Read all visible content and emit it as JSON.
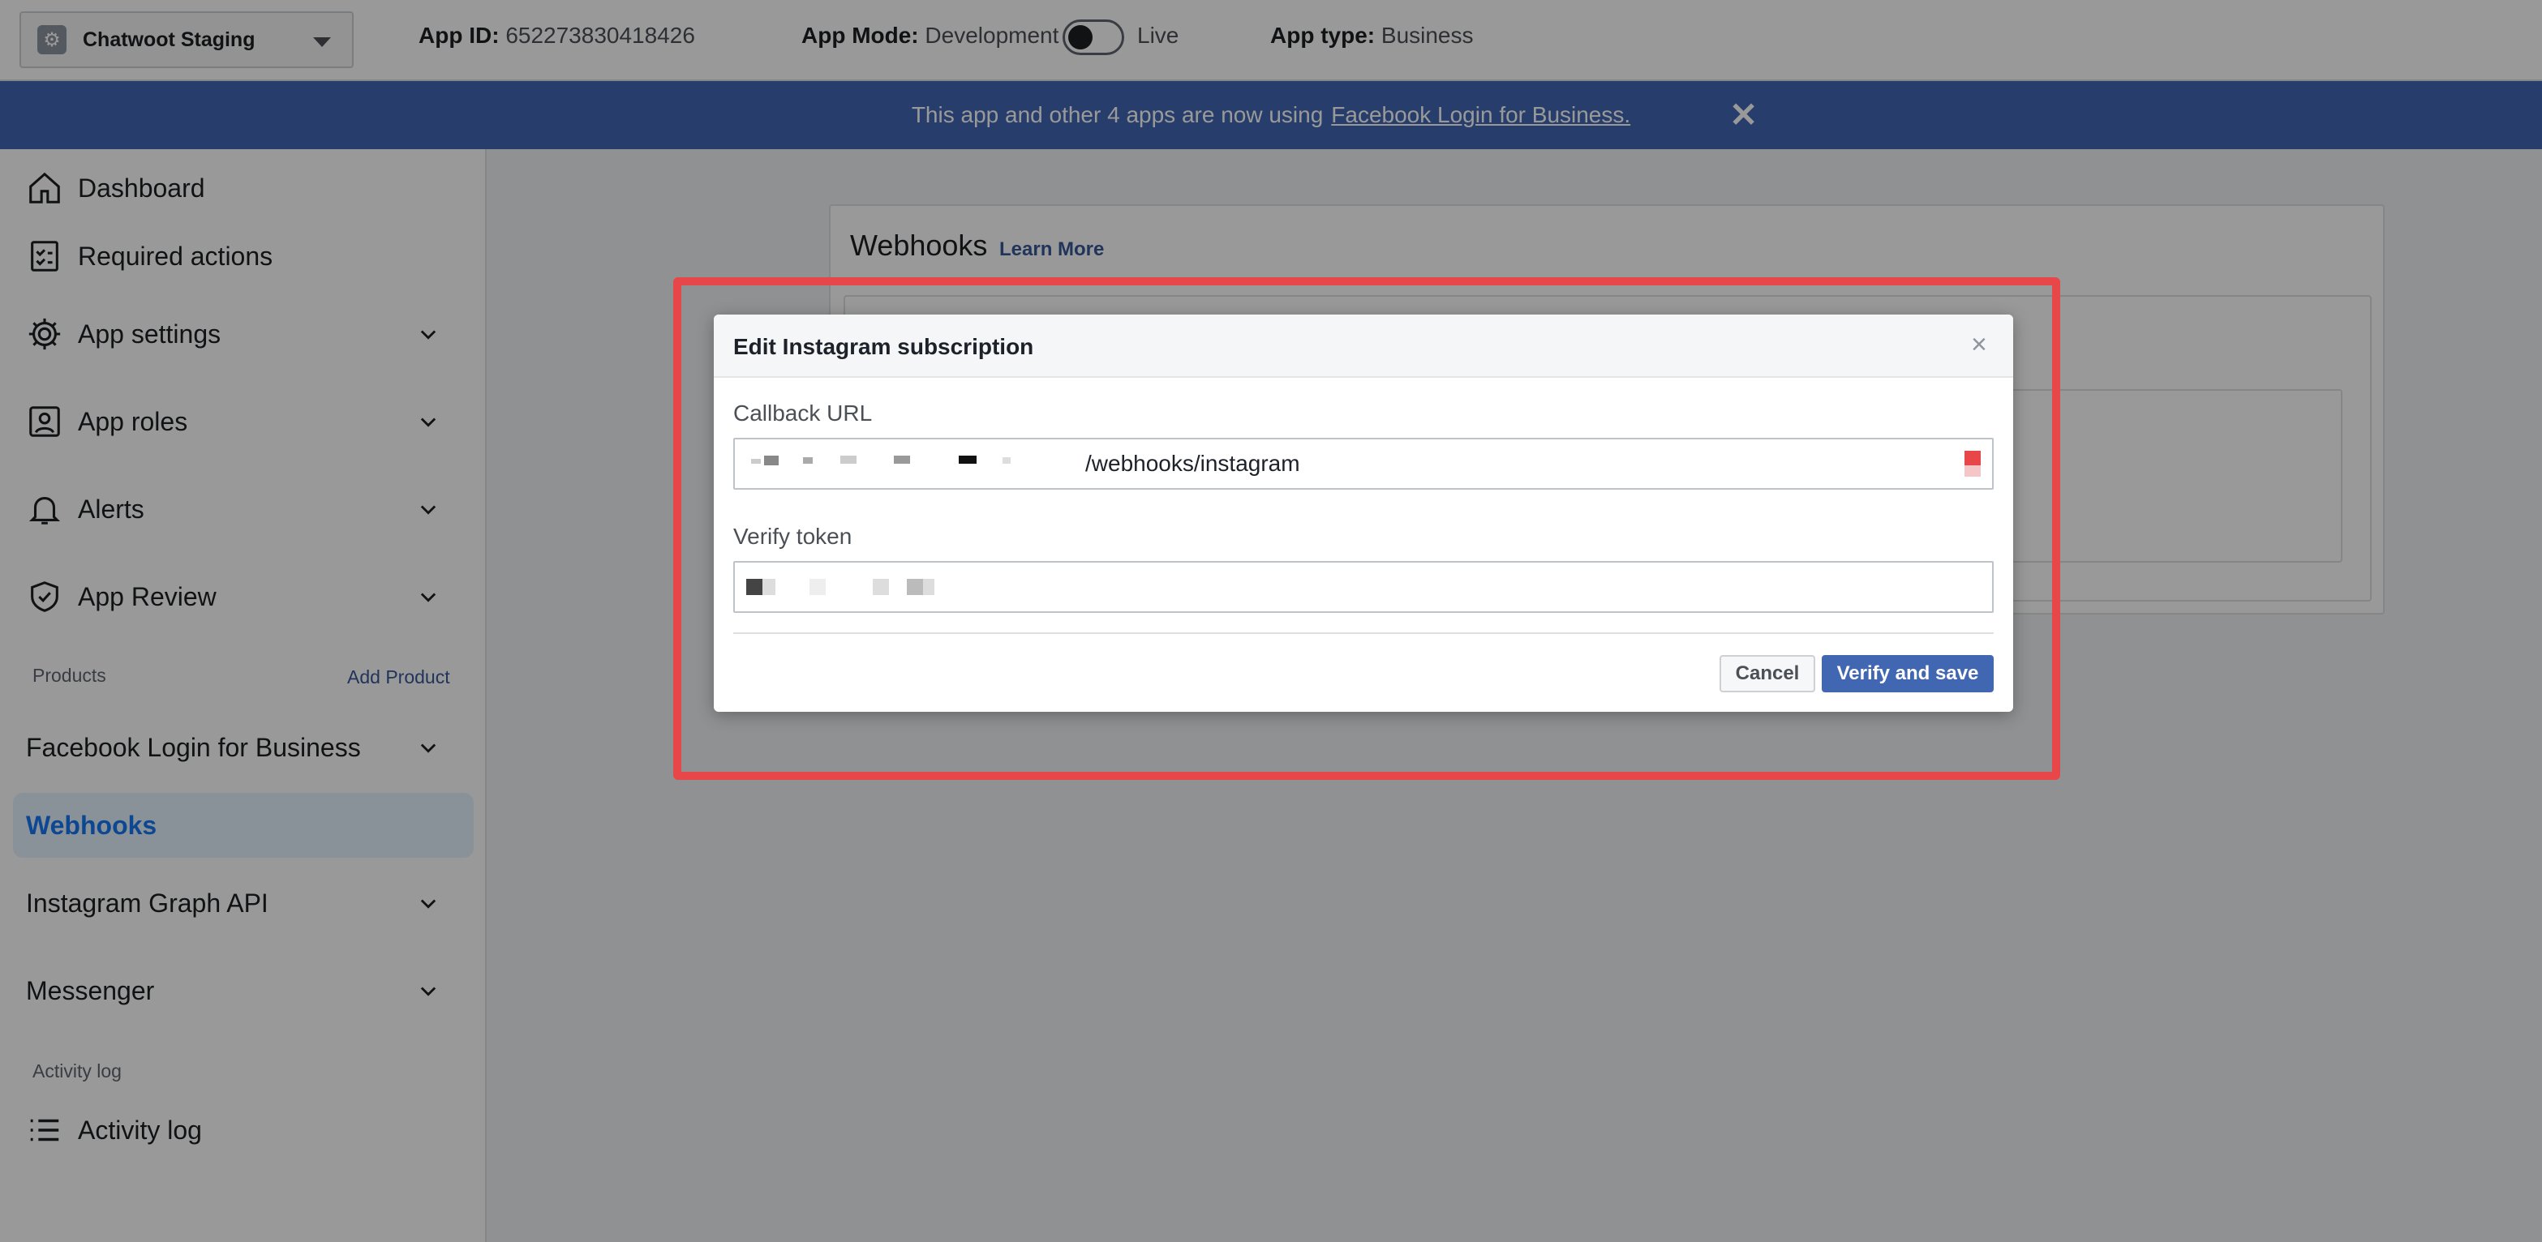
{
  "topbar": {
    "app_name": "Chatwoot Staging",
    "app_id_label": "App ID:",
    "app_id_value": "652273830418426",
    "app_mode_label": "App Mode:",
    "app_mode_value": "Development",
    "app_mode_live": "Live",
    "app_type_label": "App type:",
    "app_type_value": "Business"
  },
  "banner": {
    "text": "This app and other 4 apps are now using",
    "link": "Facebook Login for Business."
  },
  "sidebar": {
    "items": [
      {
        "label": "Dashboard"
      },
      {
        "label": "Required actions"
      },
      {
        "label": "App settings"
      },
      {
        "label": "App roles"
      },
      {
        "label": "Alerts"
      },
      {
        "label": "App Review"
      }
    ],
    "products_label": "Products",
    "add_product": "Add Product",
    "products": [
      {
        "label": "Facebook Login for Business"
      },
      {
        "label": "Webhooks"
      },
      {
        "label": "Instagram Graph API"
      },
      {
        "label": "Messenger"
      }
    ],
    "activity_section": "Activity log",
    "activity_item": "Activity log"
  },
  "main": {
    "title": "Webhooks",
    "learn_more": "Learn More"
  },
  "modal": {
    "title": "Edit Instagram subscription",
    "close": "×",
    "callback_label": "Callback URL",
    "callback_value": "/webhooks/instagram",
    "verify_label": "Verify token",
    "cancel": "Cancel",
    "save": "Verify and save"
  }
}
